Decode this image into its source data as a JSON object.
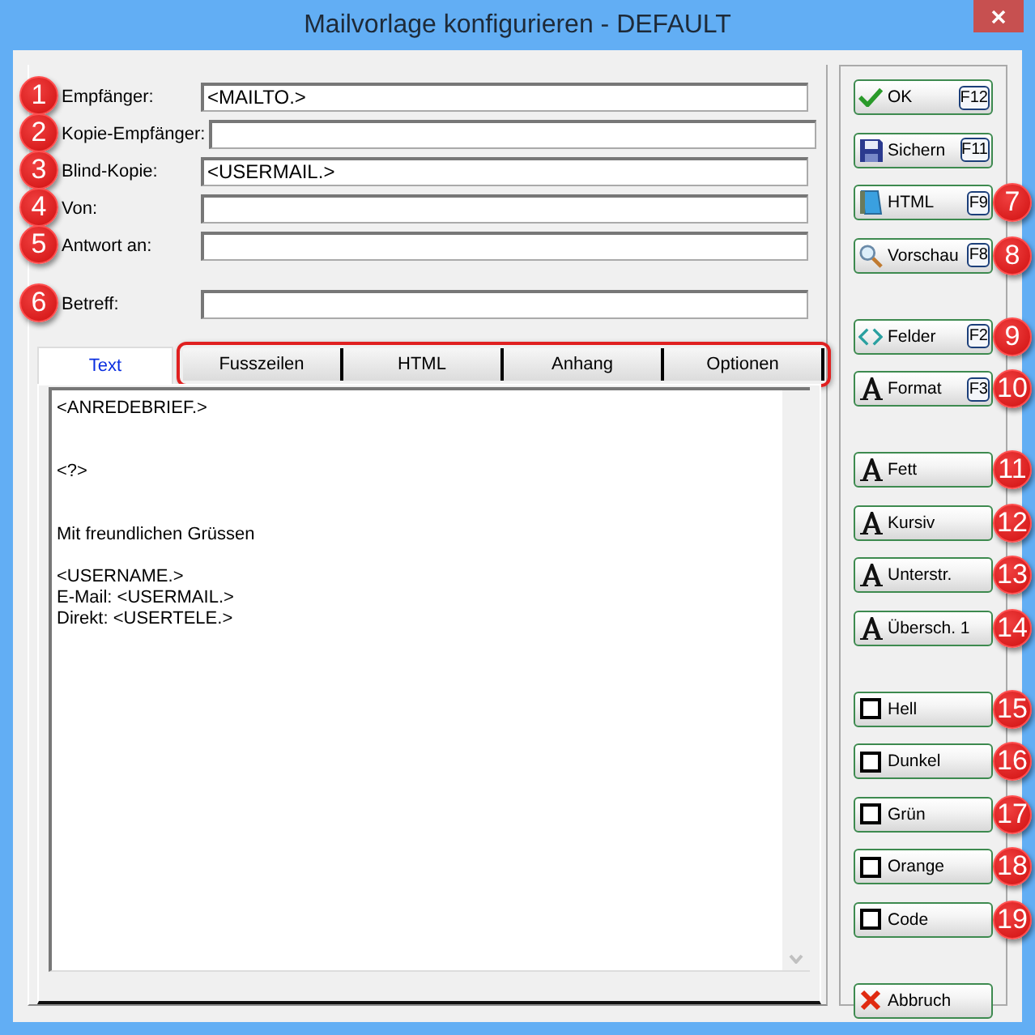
{
  "window": {
    "title": "Mailvorlage konfigurieren - DEFAULT"
  },
  "fields": [
    {
      "label": "Empfänger:",
      "value": "<MAILTO.>",
      "marker": "1",
      "kind": "address"
    },
    {
      "label": "Kopie-Empfänger:",
      "marker": "2",
      "kind": "address"
    },
    {
      "label": "Blind-Kopie:",
      "value": "<USERMAIL.>",
      "marker": "3",
      "kind": "address"
    },
    {
      "label": "Von:",
      "marker": "4",
      "kind": "address"
    },
    {
      "label": "Antwort an:",
      "marker": "5",
      "kind": "address"
    },
    {
      "label": "Betreff:",
      "marker": "6",
      "kind": "subject"
    }
  ],
  "editor": {
    "tabs": [
      {
        "label": "Text",
        "selected": true,
        "highlighted": false
      },
      {
        "label": "Fusszeilen",
        "selected": false,
        "highlighted": true
      },
      {
        "label": "HTML",
        "selected": false,
        "highlighted": true
      },
      {
        "label": "Anhang",
        "selected": false,
        "highlighted": true
      },
      {
        "label": "Optionen",
        "selected": false,
        "highlighted": true
      }
    ],
    "body": "<ANREDEBRIEF.>\n\n\n<?>\n\n\nMit freundlichen Grüssen\n\n<USERNAME.>\nE-Mail: <USERMAIL.>\nDirekt: <USERTELE.>"
  },
  "button_groups": [
    [
      {
        "label": "OK",
        "key": "F12",
        "kind": "ok"
      },
      {
        "label": "Sichern",
        "key": "F11",
        "kind": "save"
      },
      {
        "label": "HTML",
        "key": "F9",
        "kind": "html",
        "marker": "7"
      },
      {
        "label": "Vorschau",
        "key": "F8",
        "kind": "preview",
        "marker": "8"
      }
    ],
    [
      {
        "label": "Felder",
        "key": "F2",
        "kind": "fields",
        "marker": "9"
      },
      {
        "label": "Format",
        "key": "F3",
        "kind": "font",
        "marker": "10"
      }
    ],
    [
      {
        "label": "Fett",
        "kind": "font",
        "marker": "11"
      },
      {
        "label": "Kursiv",
        "kind": "font",
        "marker": "12"
      },
      {
        "label": "Unterstr.",
        "kind": "font",
        "marker": "13"
      },
      {
        "label": "Übersch. 1",
        "kind": "font",
        "marker": "14"
      }
    ],
    [
      {
        "label": "Hell",
        "kind": "color",
        "marker": "15"
      },
      {
        "label": "Dunkel",
        "kind": "color",
        "marker": "16"
      },
      {
        "label": "Grün",
        "kind": "color",
        "marker": "17"
      },
      {
        "label": "Orange",
        "kind": "color",
        "marker": "18"
      },
      {
        "label": "Code",
        "kind": "color",
        "marker": "19"
      }
    ],
    [
      {
        "label": "Abbruch",
        "kind": "cancel"
      }
    ]
  ]
}
